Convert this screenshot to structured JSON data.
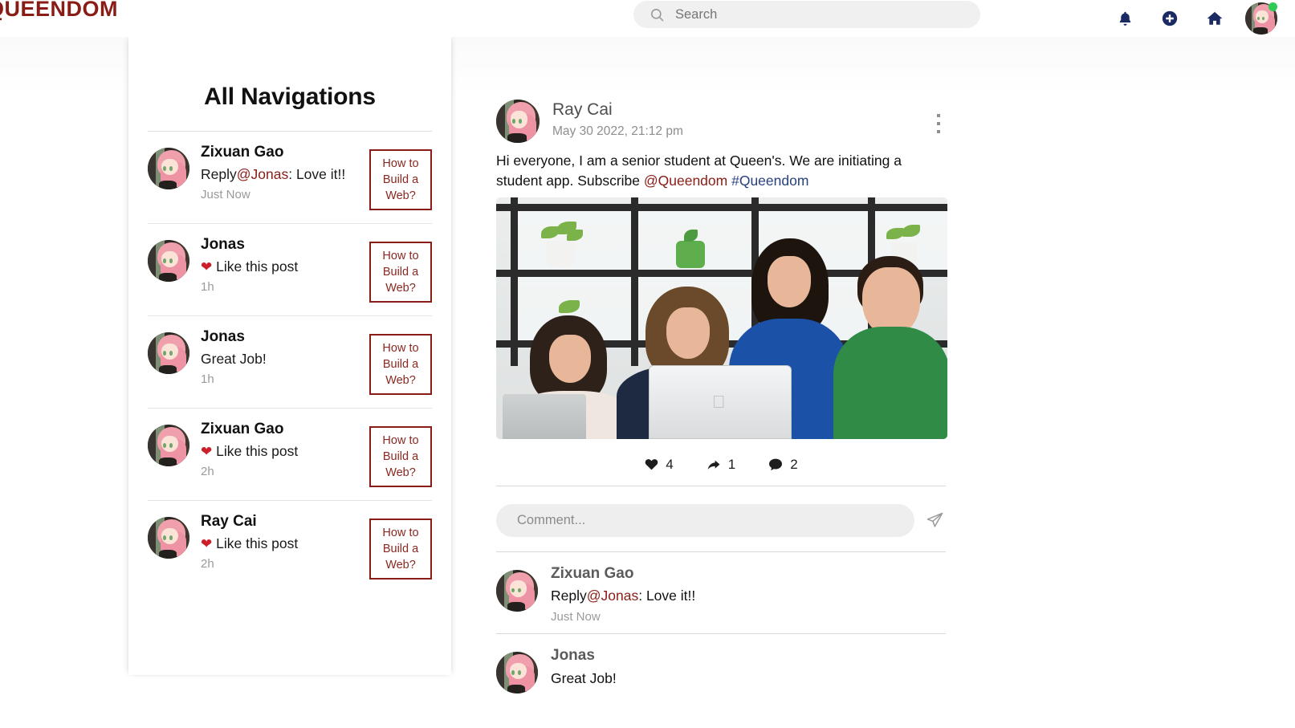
{
  "header": {
    "brand": "QUEENDOM",
    "search": {
      "placeholder": "Search",
      "value": ""
    },
    "icons": {
      "bell": "notifications-bell-icon",
      "plus": "create-post-icon",
      "home": "home-icon",
      "avatar": "profile-avatar"
    }
  },
  "sidebar": {
    "title": "All Navigations",
    "items": [
      {
        "name": "Zixuan Gao",
        "text_prefix": "Reply",
        "mention": "@Jonas",
        "text_suffix": ": Love it!!",
        "heart": "",
        "time": "Just Now",
        "post_title": "How to Build a Web?"
      },
      {
        "name": "Jonas",
        "text_prefix": "",
        "mention": "",
        "text_suffix": "Like this post",
        "heart": "❤",
        "time": "1h",
        "post_title": "How to Build a Web?"
      },
      {
        "name": "Jonas",
        "text_prefix": "",
        "mention": "",
        "text_suffix": "Great Job!",
        "heart": "",
        "time": "1h",
        "post_title": "How to Build a Web?"
      },
      {
        "name": "Zixuan Gao",
        "text_prefix": "",
        "mention": "",
        "text_suffix": "Like this post",
        "heart": "❤",
        "time": "2h",
        "post_title": "How to Build a Web?"
      },
      {
        "name": "Ray Cai",
        "text_prefix": "",
        "mention": "",
        "text_suffix": "Like this post",
        "heart": "❤",
        "time": "2h",
        "post_title": "How to Build a Web?"
      }
    ]
  },
  "post": {
    "author": "Ray Cai",
    "date": "May 30 2022, 21:12 pm",
    "body_part1": "Hi everyone, I am a senior student at Queen's. We are initiating a student app. Subscribe ",
    "body_mention": "@Queendom",
    "body_space": " ",
    "body_hashtag": "#Queendom",
    "image_alt": "four-people-looking-at-laptop-photo",
    "menu_icon": "more-options-icon",
    "stats": {
      "likes": "4",
      "shares": "1",
      "comments": "2"
    }
  },
  "comment_box": {
    "placeholder": "Comment...",
    "value": "",
    "send_icon": "send-paper-plane-icon"
  },
  "comments": [
    {
      "name": "Zixuan Gao",
      "text_prefix": "Reply",
      "mention": "@Jonas",
      "text_suffix": ": Love it!!",
      "time": "Just Now"
    },
    {
      "name": "Jonas",
      "text_prefix": "",
      "mention": "",
      "text_suffix": "Great Job!",
      "time": ""
    }
  ],
  "colors": {
    "brand_red": "#8a1c16",
    "nav_navy": "#1b2a63",
    "heart_red": "#cc1f2a",
    "hashtag_blue": "#28417e",
    "online_green": "#2ecc55"
  }
}
